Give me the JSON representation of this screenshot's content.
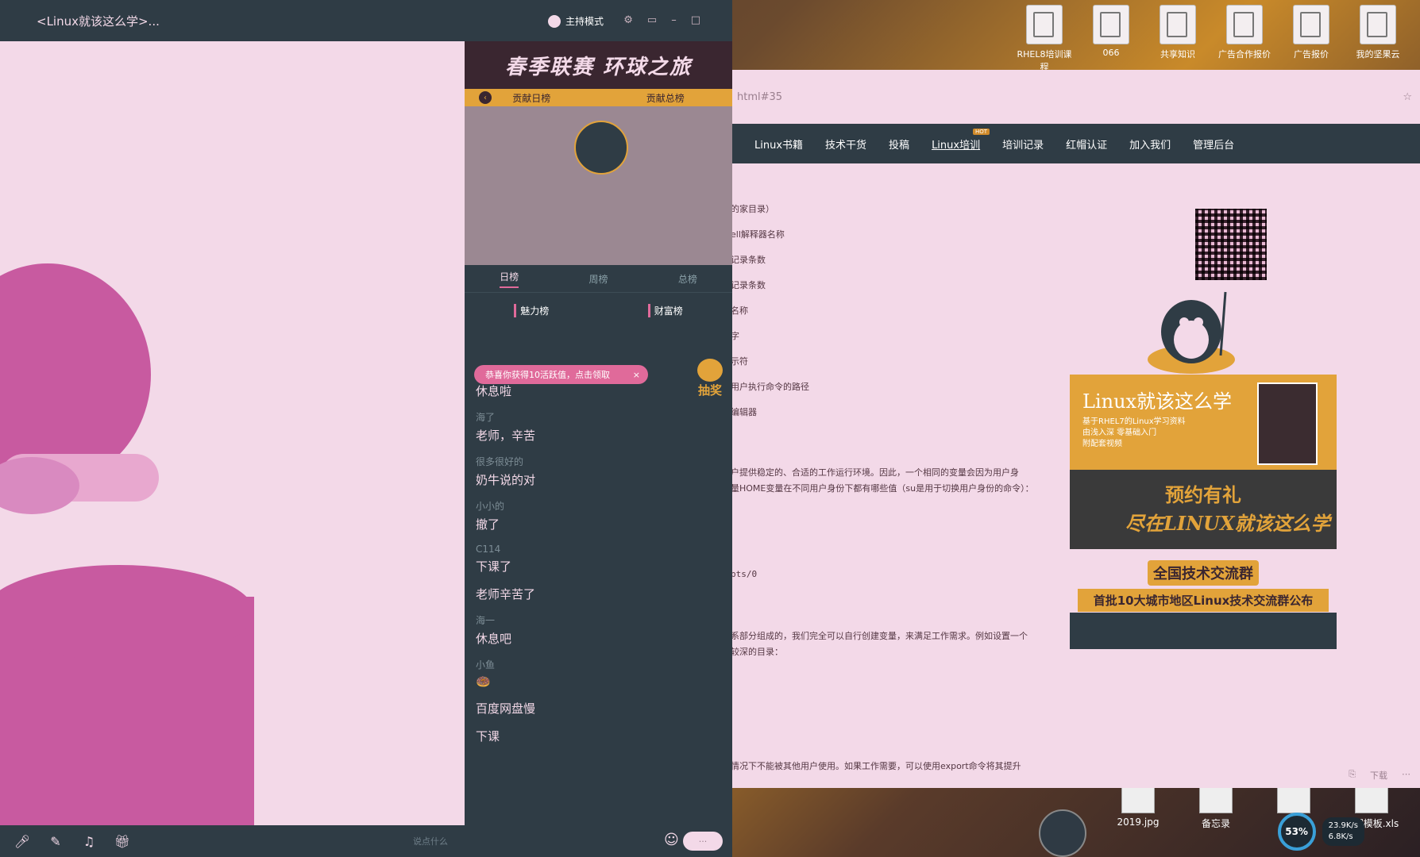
{
  "desktop": {
    "icons": [
      "RHEL8培训课程",
      "066",
      "共享知识",
      "广告合作报价",
      "广告报价",
      "我的坚果云"
    ],
    "files": [
      "2019.jpg",
      "备忘录",
      "",
      "数据模板.xls"
    ],
    "network": {
      "percent": "53%",
      "up": "23.9K/s",
      "down": "6.8K/s"
    }
  },
  "browser": {
    "url_fragment": "html#35",
    "nav": [
      {
        "label": "Linux书籍"
      },
      {
        "label": "技术干货"
      },
      {
        "label": "投稿"
      },
      {
        "label": "Linux培训",
        "badge": "HOT"
      },
      {
        "label": "培训记录"
      },
      {
        "label": "红帽认证"
      },
      {
        "label": "加入我们"
      },
      {
        "label": "管理后台"
      }
    ],
    "toc": [
      "的家目录）",
      "ell解释器名称",
      "记录条数",
      "记录条数",
      "",
      "名称",
      "字",
      "示符",
      "用户执行命令的路径",
      "编辑器"
    ],
    "paragraph1": [
      "户提供稳定的、合适的工作运行环境。因此，一个相同的变量会因为用户身",
      "量HOME变量在不同用户身份下都有哪些值（su是用于切换用户身份的命令）："
    ],
    "code": "pts/0",
    "paragraph2": [
      "系部分组成的，我们完全可以自行创建变量，来满足工作需求。例如设置一个",
      "较深的目录："
    ],
    "paragraph3": "情况下不能被其他用户使用。如果工作需要，可以使用export命令将其提升",
    "ad1_title": "Linux就该这么学",
    "ad1_lines": [
      "基于RHEL7的Linux学习资料",
      "由浅入深 零基础入门",
      "附配套视频"
    ],
    "ad2_line1": "预约有礼",
    "ad2_line2": "尽在LINUX就该这么学",
    "ad3_line1": "全国技术交流群",
    "ad3_line2": "首批10大城市地区Linux技术交流群公布",
    "scroll_tools": [
      "下载"
    ]
  },
  "app": {
    "title": "<Linux就该这么学>...",
    "host_mode": "主持模式",
    "banner": "春季联赛 环球之旅",
    "rank_tabs": [
      "贡献日榜",
      "贡献总榜"
    ],
    "tabs": [
      "日榜",
      "周榜",
      "总榜"
    ],
    "lists": [
      "魅力榜",
      "财富榜"
    ],
    "notice": "恭喜你获得10活跃值，点击领取",
    "lottery": "抽奖",
    "chat": [
      {
        "user": "",
        "content": "休息啦"
      },
      {
        "user": "海了",
        "content": "老师，辛苦"
      },
      {
        "user": "很多很好的",
        "content": "奶牛说的对"
      },
      {
        "user": "小小的",
        "content": "撤了"
      },
      {
        "user": "C114",
        "content": "下课了"
      },
      {
        "user": "",
        "content": "老师辛苦了"
      },
      {
        "user": "海一",
        "content": "休息吧"
      },
      {
        "user": "小鱼",
        "content": "🍩"
      },
      {
        "user": "",
        "content": "百度网盘慢"
      },
      {
        "user": "",
        "content": "下课"
      }
    ],
    "input_hint": "说点什么"
  }
}
